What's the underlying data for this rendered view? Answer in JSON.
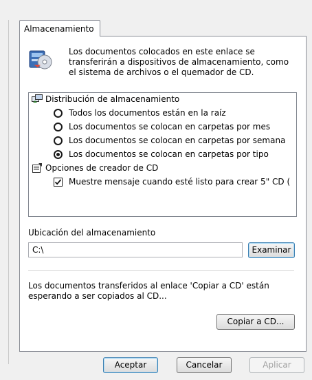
{
  "tab": {
    "label": "Almacenamiento"
  },
  "intro": {
    "icon": "storage-device-icon",
    "text": "Los documentos colocados en este enlace se transferirán a dispositivos de almacenamiento, como el sistema de archivos o el quemador de CD."
  },
  "tree": {
    "group_distribution": {
      "icon": "storage-distribution-icon",
      "label": "Distribución de almacenamiento"
    },
    "options": [
      {
        "label": "Todos los documentos están en la raíz",
        "selected": false
      },
      {
        "label": "Los documentos se colocan en carpetas por mes",
        "selected": false
      },
      {
        "label": "Los documentos se colocan en carpetas por semana",
        "selected": false
      },
      {
        "label": "Los documentos se colocan en carpetas por tipo",
        "selected": true
      }
    ],
    "group_cd": {
      "icon": "cd-creator-options-icon",
      "label": "Opciones de creador de CD"
    },
    "cd_option": {
      "label": "Muestre mensaje cuando esté listo para crear 5\" CD (",
      "checked": true
    }
  },
  "location": {
    "label": "Ubicación del almacenamiento",
    "value": "C:\\",
    "browse_label": "Examinar"
  },
  "status": {
    "text": "Los documentos transferidos al enlace 'Copiar a CD' están esperando a ser copiados al CD...",
    "copy_label": "Copiar a CD..."
  },
  "footer": {
    "ok_label": "Aceptar",
    "cancel_label": "Cancelar",
    "apply_label": "Aplicar"
  }
}
